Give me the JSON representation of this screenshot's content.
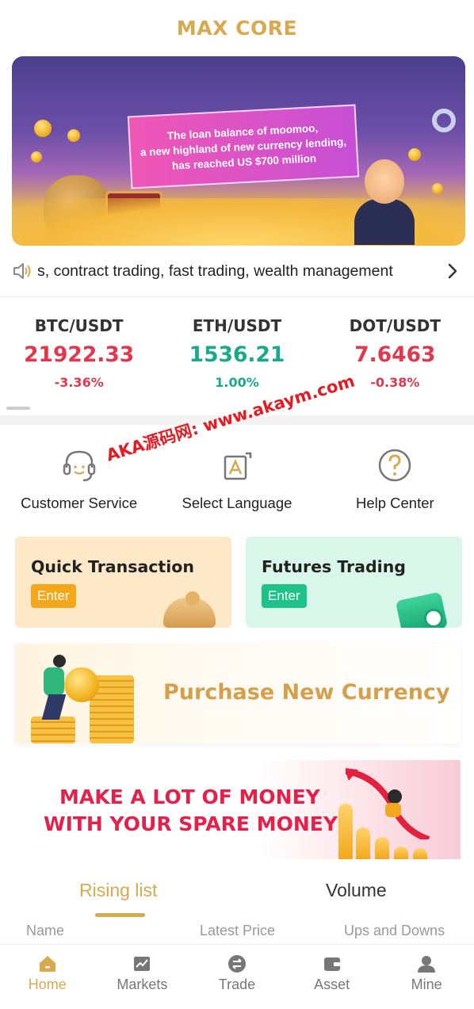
{
  "header": {
    "title": "MAX CORE"
  },
  "banner": {
    "line1": "The loan balance of moomoo,",
    "line2": "a new highland of new currency lending,",
    "line3": "has reached US $700 million"
  },
  "notice": {
    "text": "s, contract trading, fast trading, wealth management"
  },
  "tickers": [
    {
      "pair": "BTC/USDT",
      "price": "21922.33",
      "change": "-3.36%",
      "direction": "down"
    },
    {
      "pair": "ETH/USDT",
      "price": "1536.21",
      "change": "1.00%",
      "direction": "up"
    },
    {
      "pair": "DOT/USDT",
      "price": "7.6463",
      "change": "-0.38%",
      "direction": "down"
    }
  ],
  "shortcuts": [
    {
      "label": "Customer Service",
      "icon": "headset-icon"
    },
    {
      "label": "Select Language",
      "icon": "language-icon"
    },
    {
      "label": "Help Center",
      "icon": "question-icon"
    }
  ],
  "cards": {
    "quick": {
      "title": "Quick Transaction",
      "enter": "Enter"
    },
    "futures": {
      "title": "Futures Trading",
      "enter": "Enter"
    }
  },
  "promo": {
    "purchase": "Purchase New Currency",
    "spare_line1": "MAKE A LOT OF MONEY",
    "spare_line2": "WITH YOUR SPARE MONEY"
  },
  "list": {
    "tabs": [
      "Rising list",
      "Volume"
    ],
    "columns": [
      "Name",
      "Latest Price",
      "Ups and Downs"
    ]
  },
  "nav": [
    {
      "label": "Home",
      "icon": "home-icon",
      "active": true
    },
    {
      "label": "Markets",
      "icon": "chart-icon",
      "active": false
    },
    {
      "label": "Trade",
      "icon": "exchange-icon",
      "active": false
    },
    {
      "label": "Asset",
      "icon": "wallet-icon",
      "active": false
    },
    {
      "label": "Mine",
      "icon": "user-icon",
      "active": false
    }
  ],
  "watermark": {
    "text": "AKA源码网: www.akaym.com"
  },
  "colors": {
    "accent": "#d8a94e",
    "down": "#e0384c",
    "up": "#1aa98b"
  }
}
